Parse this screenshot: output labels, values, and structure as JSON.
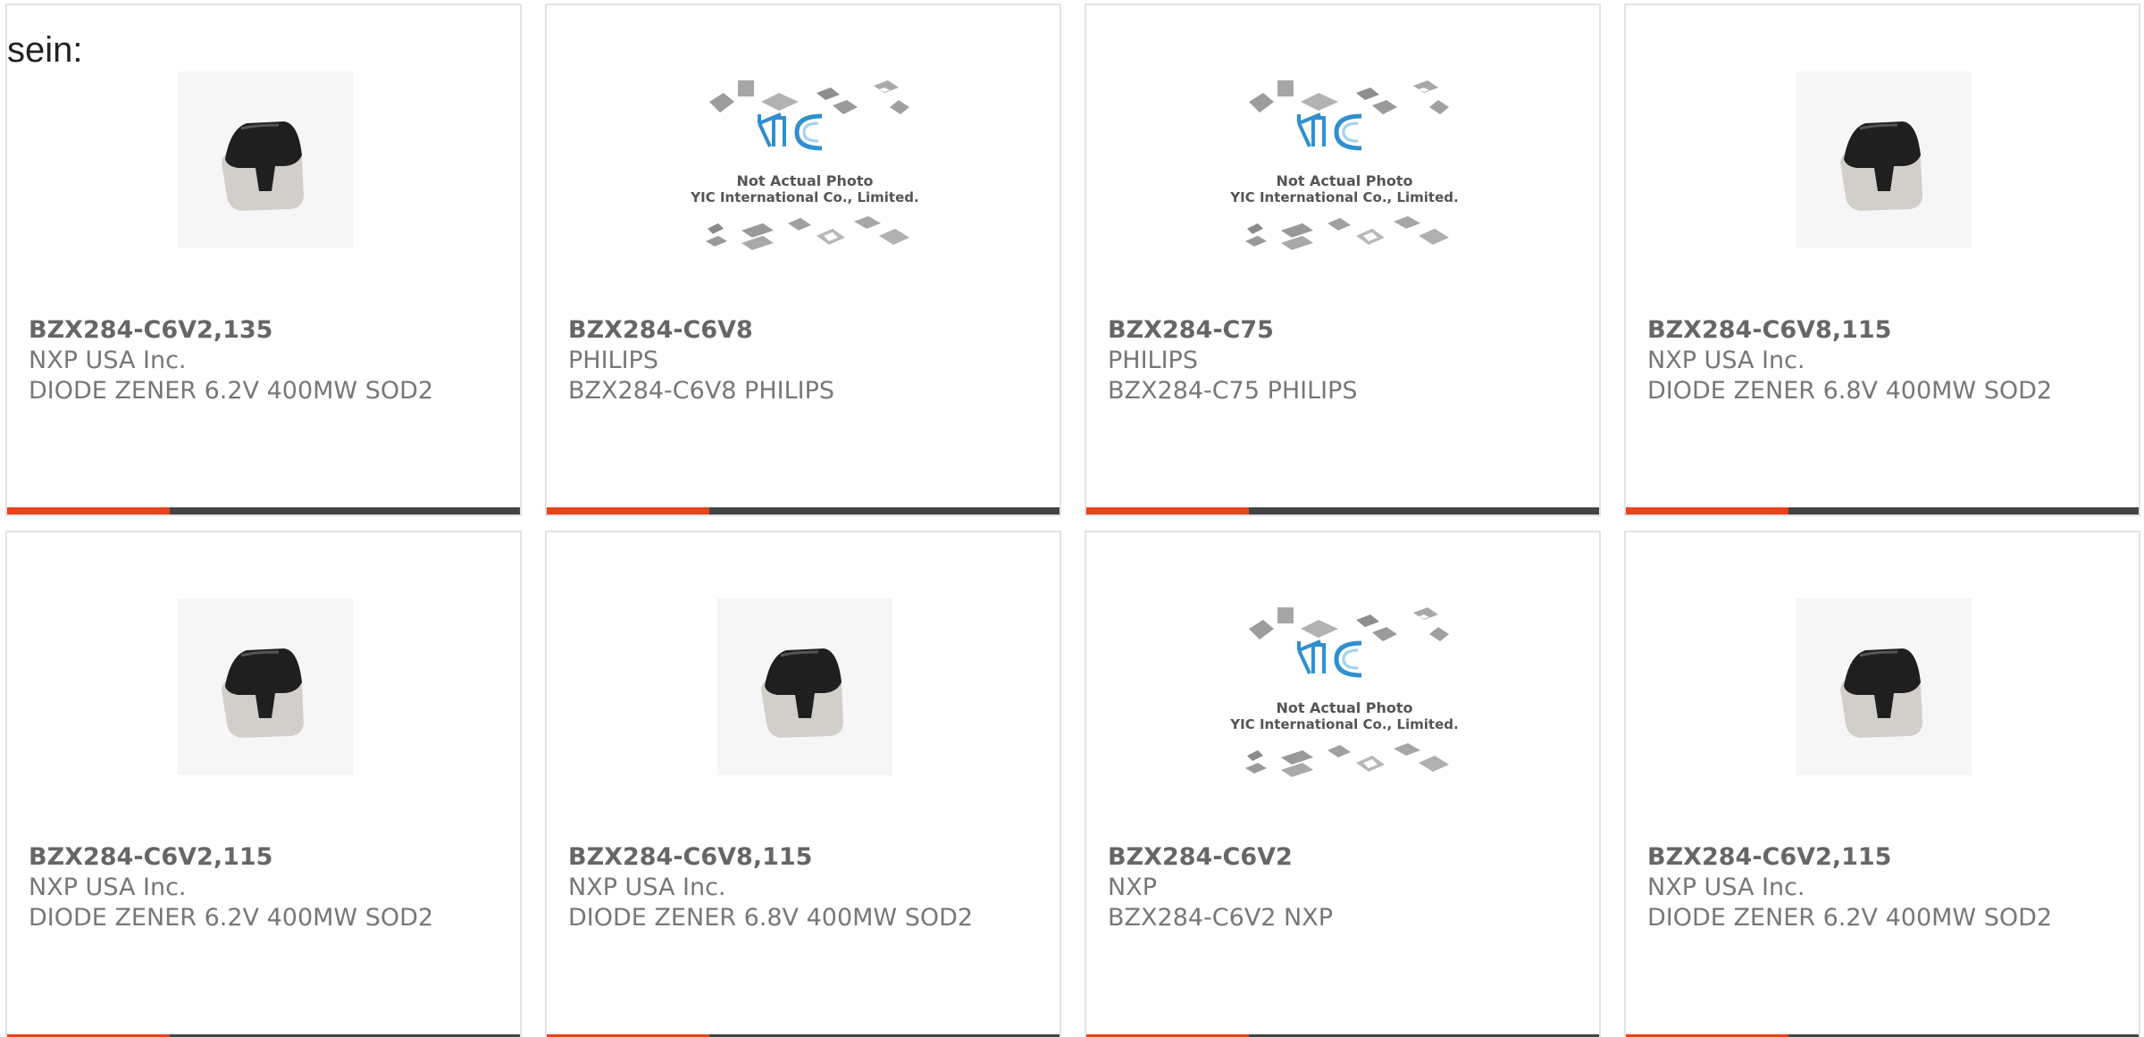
{
  "intro_text": "sein:",
  "colors": {
    "accent": "#e8431c",
    "bar_dark": "#444444",
    "brand_blue": "#2f8fcf"
  },
  "placeholder_image": {
    "line1": "Not Actual Photo",
    "line2": "YIC International Co., Limited."
  },
  "products": [
    {
      "part_number": "BZX284-C6V2,135",
      "manufacturer": "NXP USA Inc.",
      "description": "DIODE ZENER 6.2V 400MW SOD2",
      "image": "diode-photo"
    },
    {
      "part_number": "BZX284-C6V8",
      "manufacturer": "PHILIPS",
      "description": "BZX284-C6V8 PHILIPS",
      "image": "not-actual-photo"
    },
    {
      "part_number": "BZX284-C75",
      "manufacturer": "PHILIPS",
      "description": "BZX284-C75 PHILIPS",
      "image": "not-actual-photo"
    },
    {
      "part_number": "BZX284-C6V8,115",
      "manufacturer": "NXP USA Inc.",
      "description": "DIODE ZENER 6.8V 400MW SOD2",
      "image": "diode-photo"
    },
    {
      "part_number": "BZX284-C6V2,115",
      "manufacturer": "NXP USA Inc.",
      "description": "DIODE ZENER 6.2V 400MW SOD2",
      "image": "diode-photo"
    },
    {
      "part_number": "BZX284-C6V8,115",
      "manufacturer": "NXP USA Inc.",
      "description": "DIODE ZENER 6.8V 400MW SOD2",
      "image": "diode-photo"
    },
    {
      "part_number": "BZX284-C6V2",
      "manufacturer": "NXP",
      "description": "BZX284-C6V2 NXP",
      "image": "not-actual-photo"
    },
    {
      "part_number": "BZX284-C6V2,115",
      "manufacturer": "NXP USA Inc.",
      "description": "DIODE ZENER 6.2V 400MW SOD2",
      "image": "diode-photo"
    }
  ]
}
